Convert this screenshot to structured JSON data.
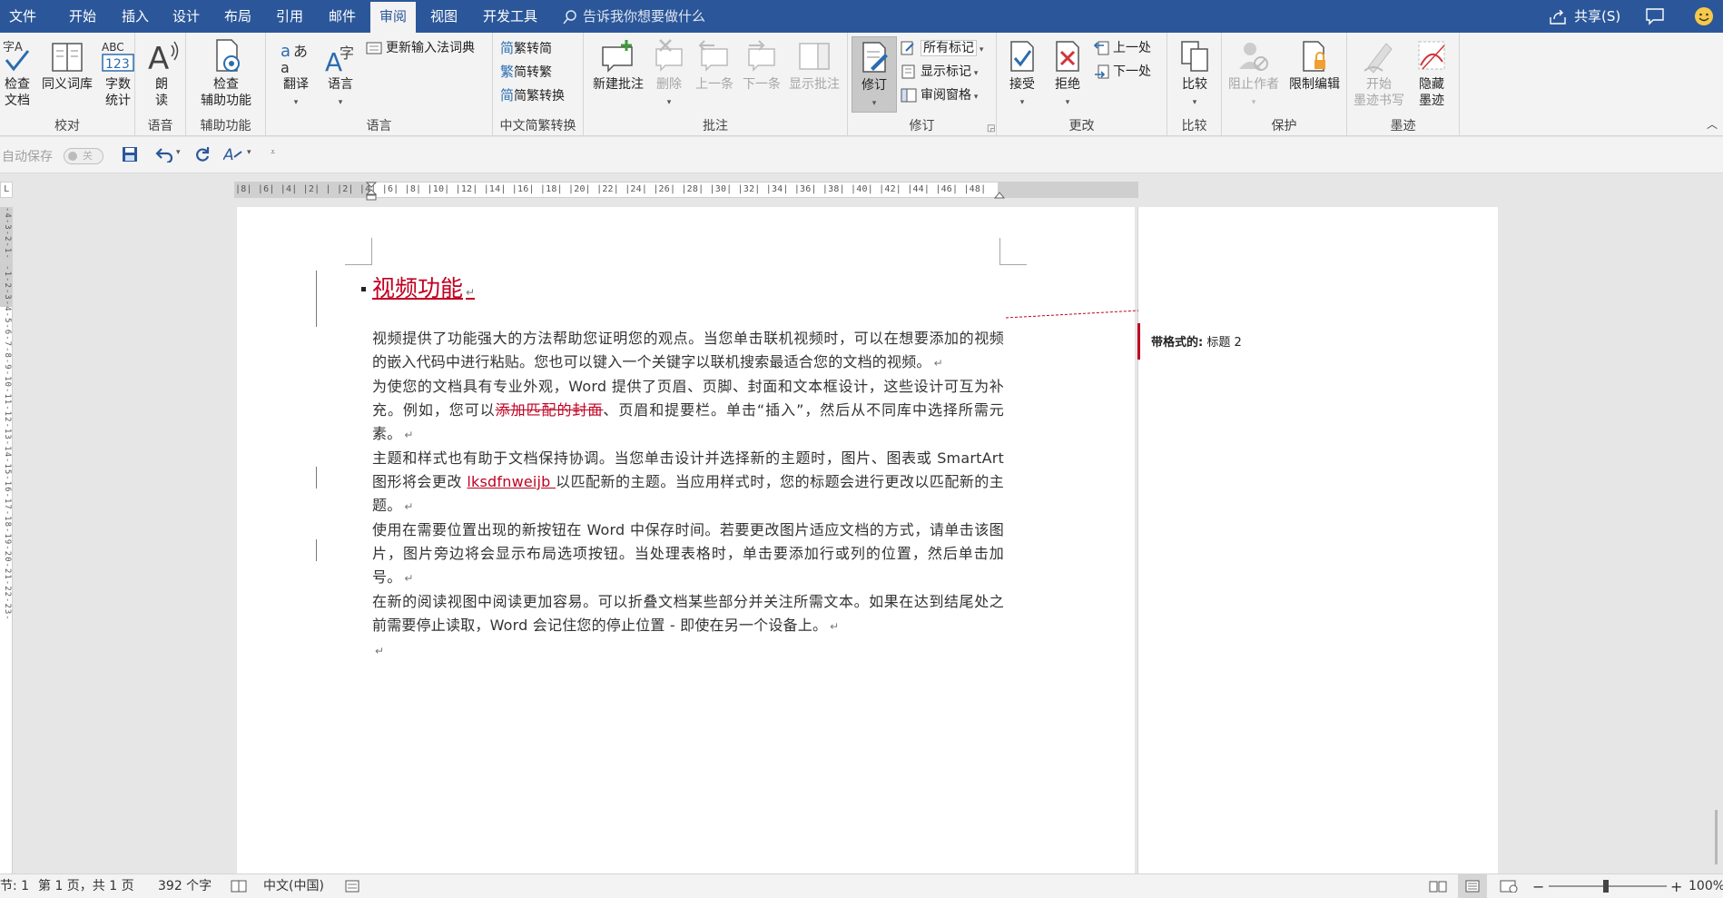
{
  "tabs": {
    "file": "文件",
    "home": "开始",
    "insert": "插入",
    "design": "设计",
    "layout": "布局",
    "references": "引用",
    "mailings": "邮件",
    "review": "审阅",
    "view": "视图",
    "developer": "开发工具",
    "tell_me": "告诉我你想要做什么",
    "share": "共享(S)"
  },
  "ribbon": {
    "proofing": {
      "label": "校对",
      "spelling": "检查\n文档",
      "thesaurus": "同义词库",
      "word_count": "字数\n统计"
    },
    "speech": {
      "label": "语音",
      "read_aloud": "朗\n读"
    },
    "accessibility": {
      "label": "辅助功能",
      "check": "检查\n辅助功能"
    },
    "language": {
      "label": "语言",
      "translate": "翻译",
      "language": "语言",
      "update_ime": "更新输入法词典"
    },
    "chinese_conversion": {
      "label": "中文简繁转换",
      "to_simplified": "繁转简",
      "to_traditional": "简转繁",
      "convert": "简繁转换"
    },
    "comments": {
      "label": "批注",
      "new": "新建批注",
      "delete": "删除",
      "previous": "上一条",
      "next": "下一条",
      "show": "显示批注"
    },
    "tracking": {
      "label": "修订",
      "track_changes": "修订",
      "all_markup": "所有标记",
      "show_markup": "显示标记",
      "reviewing_pane": "审阅窗格"
    },
    "changes": {
      "label": "更改",
      "accept": "接受",
      "reject": "拒绝",
      "previous": "上一处",
      "next": "下一处"
    },
    "compare": {
      "label": "比较",
      "compare": "比较"
    },
    "protect": {
      "label": "保护",
      "block_authors": "阻止作者",
      "restrict": "限制编辑"
    },
    "ink": {
      "label": "墨迹",
      "start_inking": "开始\n墨迹书写",
      "hide_ink": "隐藏\n墨迹"
    }
  },
  "qat": {
    "autosave": "自动保存",
    "autosave_state": "关"
  },
  "ruler": {
    "horizontal": "|8|  |6|  |4|  |2|  |  |2|  |4|  |6|  |8|  |10|  |12|  |14|  |16|  |18|  |20|  |22|  |24|  |26|  |28|  |30|  |32|  |34|  |36|  |38|  |40|  |42|  |44|  |46|  |48|",
    "vertical": "-4-3-2-1-  -1-2-3-4-5-6-7-8-9-10-11-12-13-14-15-16-17-18-19-20-21-22-23-",
    "corner": "L"
  },
  "document": {
    "heading": "视频功能",
    "p1": "视频提供了功能强大的方法帮助您证明您的观点。当您单击联机视频时，可以在想要添加的视频的嵌入代码中进行粘贴。您也可以键入一个关键字以联机搜索最适合您的文档的视频。",
    "p2_before": "为使您的文档具有专业外观，Word 提供了页眉、页脚、封面和文本框设计，这些设计可互为补充。例如，您可以",
    "p2_deleted": "添加匹配的封面",
    "p2_after": "、页眉和提要栏。单击“插入”，然后从不同库中选择所需元素。",
    "p3_before": "主题和样式也有助于文档保持协调。当您单击设计并选择新的主题时，图片、图表或 SmartArt 图形将会更改 ",
    "p3_inserted": "lksdfnweijb ",
    "p3_after": "以匹配新的主题。当应用样式时，您的标题会进行更改以匹配新的主题。",
    "p4": "使用在需要位置出现的新按钮在 Word 中保存时间。若要更改图片适应文档的方式，请单击该图片，图片旁边将会显示布局选项按钮。当处理表格时，单击要添加行或列的位置，然后单击加号。",
    "p5": "在新的阅读视图中阅读更加容易。可以折叠文档某些部分并关注所需文本。如果在达到结尾处之前需要停止读取，Word 会记住您的停止位置 - 即使在另一个设备上。",
    "para_mark": "↵"
  },
  "balloon": {
    "label": "带格式的:",
    "value": "标题 2"
  },
  "status": {
    "section": "节: 1",
    "page": "第 1 页，共 1 页",
    "words": "392 个字",
    "language": "中文(中国)",
    "zoom": "100%"
  },
  "colors": {
    "brand": "#2b579a",
    "revision": "#c00022"
  }
}
